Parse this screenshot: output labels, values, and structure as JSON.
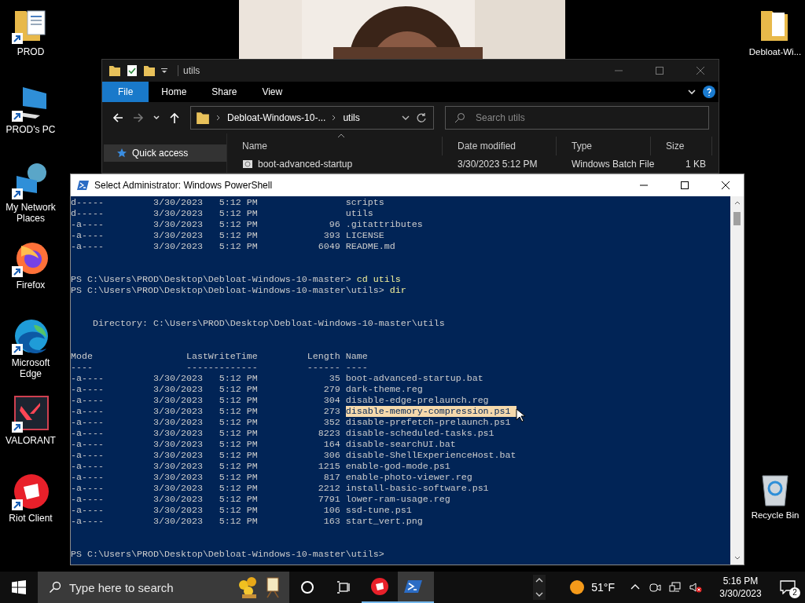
{
  "desktop_icons": [
    {
      "label": "PROD",
      "kind": "folder-doc"
    },
    {
      "label": "PROD's PC",
      "kind": "pc"
    },
    {
      "label": "My Network Places",
      "kind": "network"
    },
    {
      "label": "Firefox",
      "kind": "firefox"
    },
    {
      "label": "Microsoft Edge",
      "kind": "edge"
    },
    {
      "label": "VALORANT",
      "kind": "valorant"
    },
    {
      "label": "Riot Client",
      "kind": "riot"
    }
  ],
  "desktop_icons_right": [
    {
      "label": "Debloat-Wi...",
      "kind": "folder"
    },
    {
      "label": "Recycle Bin",
      "kind": "recycle"
    }
  ],
  "explorer": {
    "title": "utils",
    "ribbon_tabs": [
      {
        "label": "File",
        "selected": true
      },
      {
        "label": "Home",
        "selected": false
      },
      {
        "label": "Share",
        "selected": false
      },
      {
        "label": "View",
        "selected": false
      }
    ],
    "address": [
      "Debloat-Windows-10-...",
      "utils"
    ],
    "search": {
      "placeholder": "Search utils"
    },
    "nav_items": [
      {
        "label": "Quick access",
        "selected": true
      }
    ],
    "columns": [
      "Name",
      "Date modified",
      "Type",
      "Size"
    ],
    "rows": [
      {
        "name": "boot-advanced-startup",
        "date": "3/30/2023 5:12 PM",
        "type": "Windows Batch File",
        "size": "1 KB"
      }
    ]
  },
  "powershell": {
    "title": "Select Administrator: Windows PowerShell",
    "lines": [
      {
        "kind": "entry",
        "mode": "d-----",
        "date": "3/30/2023",
        "time": "5:12 PM",
        "name": "scripts",
        "selected": false
      },
      {
        "kind": "entry",
        "mode": "d-----",
        "date": "3/30/2023",
        "time": "5:12 PM",
        "name": "utils",
        "selected": false
      },
      {
        "kind": "entry",
        "mode": "-a----",
        "date": "3/30/2023",
        "time": "5:12 PM",
        "length": "96",
        "name": ".gitattributes",
        "selected": false
      },
      {
        "kind": "entry",
        "mode": "-a----",
        "date": "3/30/2023",
        "time": "5:12 PM",
        "length": "393",
        "name": "LICENSE",
        "selected": false
      },
      {
        "kind": "entry",
        "mode": "-a----",
        "date": "3/30/2023",
        "time": "5:12 PM",
        "length": "6049",
        "name": "README.md",
        "selected": false
      },
      {
        "kind": "blank"
      },
      {
        "kind": "blank"
      },
      {
        "kind": "prompt",
        "prompt": "PS C:\\Users\\PROD\\Desktop\\Debloat-Windows-10-master>",
        "command": "cd utils"
      },
      {
        "kind": "prompt",
        "prompt": "PS C:\\Users\\PROD\\Desktop\\Debloat-Windows-10-master\\utils>",
        "command": "dir"
      },
      {
        "kind": "blank"
      },
      {
        "kind": "blank"
      },
      {
        "kind": "text",
        "text": "    Directory: C:\\Users\\PROD\\Desktop\\Debloat-Windows-10-master\\utils"
      },
      {
        "kind": "blank"
      },
      {
        "kind": "blank"
      },
      {
        "kind": "text",
        "text": "Mode                 LastWriteTime         Length Name"
      },
      {
        "kind": "text",
        "text": "----                 -------------         ------ ----"
      },
      {
        "kind": "entry",
        "mode": "-a----",
        "date": "3/30/2023",
        "time": "5:12 PM",
        "length": "35",
        "name": "boot-advanced-startup.bat",
        "selected": false
      },
      {
        "kind": "entry",
        "mode": "-a----",
        "date": "3/30/2023",
        "time": "5:12 PM",
        "length": "279",
        "name": "dark-theme.reg",
        "selected": false
      },
      {
        "kind": "entry",
        "mode": "-a----",
        "date": "3/30/2023",
        "time": "5:12 PM",
        "length": "304",
        "name": "disable-edge-prelaunch.reg",
        "selected": false
      },
      {
        "kind": "entry",
        "mode": "-a----",
        "date": "3/30/2023",
        "time": "5:12 PM",
        "length": "273",
        "name": "disable-memory-compression.ps1",
        "selected": true
      },
      {
        "kind": "entry",
        "mode": "-a----",
        "date": "3/30/2023",
        "time": "5:12 PM",
        "length": "352",
        "name": "disable-prefetch-prelaunch.ps1",
        "selected": false
      },
      {
        "kind": "entry",
        "mode": "-a----",
        "date": "3/30/2023",
        "time": "5:12 PM",
        "length": "8223",
        "name": "disable-scheduled-tasks.ps1",
        "selected": false
      },
      {
        "kind": "entry",
        "mode": "-a----",
        "date": "3/30/2023",
        "time": "5:12 PM",
        "length": "164",
        "name": "disable-searchUI.bat",
        "selected": false
      },
      {
        "kind": "entry",
        "mode": "-a----",
        "date": "3/30/2023",
        "time": "5:12 PM",
        "length": "306",
        "name": "disable-ShellExperienceHost.bat",
        "selected": false
      },
      {
        "kind": "entry",
        "mode": "-a----",
        "date": "3/30/2023",
        "time": "5:12 PM",
        "length": "1215",
        "name": "enable-god-mode.ps1",
        "selected": false
      },
      {
        "kind": "entry",
        "mode": "-a----",
        "date": "3/30/2023",
        "time": "5:12 PM",
        "length": "817",
        "name": "enable-photo-viewer.reg",
        "selected": false
      },
      {
        "kind": "entry",
        "mode": "-a----",
        "date": "3/30/2023",
        "time": "5:12 PM",
        "length": "2212",
        "name": "install-basic-software.ps1",
        "selected": false
      },
      {
        "kind": "entry",
        "mode": "-a----",
        "date": "3/30/2023",
        "time": "5:12 PM",
        "length": "7791",
        "name": "lower-ram-usage.reg",
        "selected": false
      },
      {
        "kind": "entry",
        "mode": "-a----",
        "date": "3/30/2023",
        "time": "5:12 PM",
        "length": "106",
        "name": "ssd-tune.ps1",
        "selected": false
      },
      {
        "kind": "entry",
        "mode": "-a----",
        "date": "3/30/2023",
        "time": "5:12 PM",
        "length": "163",
        "name": "start_vert.png",
        "selected": false
      },
      {
        "kind": "blank"
      },
      {
        "kind": "blank"
      },
      {
        "kind": "prompt",
        "prompt": "PS C:\\Users\\PROD\\Desktop\\Debloat-Windows-10-master\\utils>"
      }
    ]
  },
  "taskbar": {
    "search": {
      "placeholder": "Type here to search"
    },
    "apps": [
      {
        "kind": "riot",
        "running": true,
        "selected": false
      },
      {
        "kind": "powershell",
        "running": true,
        "selected": true
      }
    ],
    "weather": "51°F",
    "time": "5:16 PM",
    "date": "3/30/2023",
    "notifications": "2"
  }
}
